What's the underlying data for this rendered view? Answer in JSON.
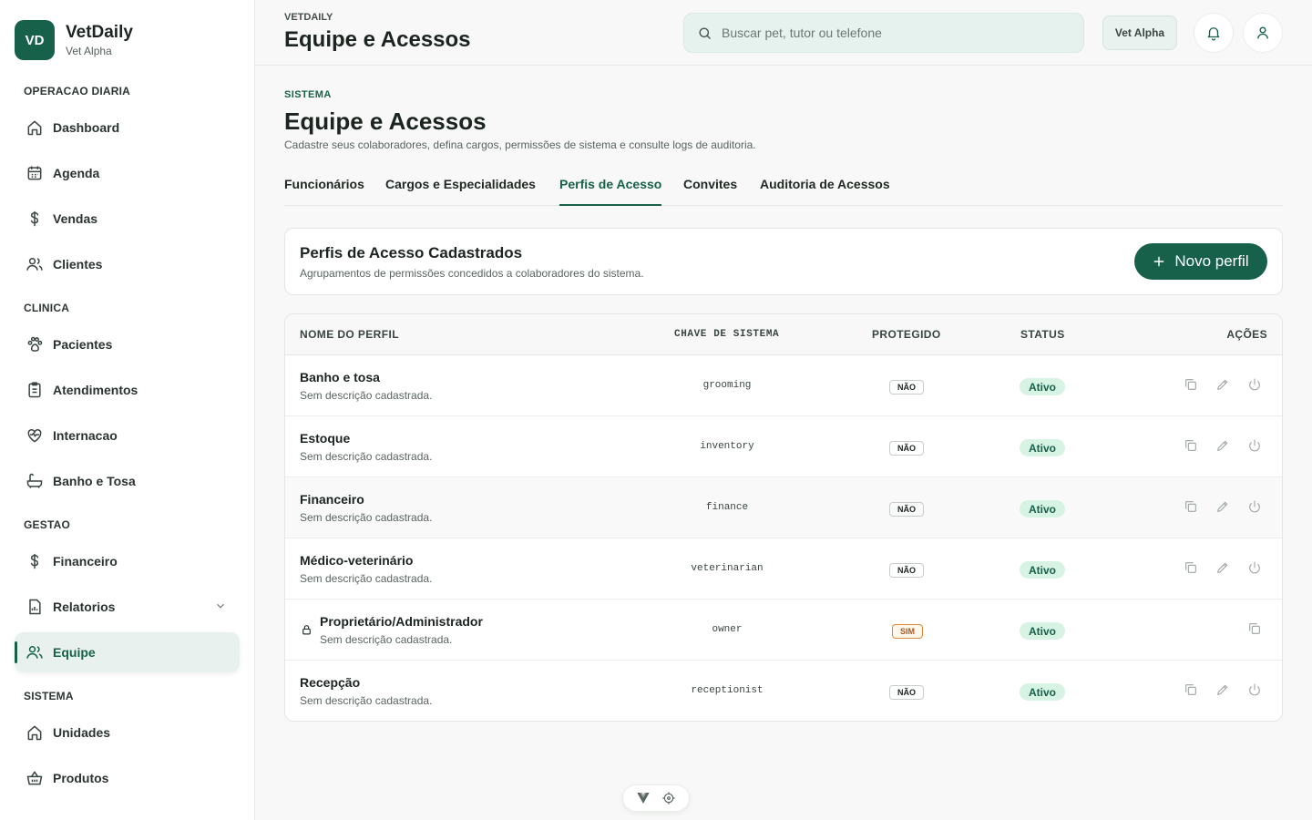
{
  "brand": {
    "initials": "VD",
    "name": "VetDaily",
    "unit": "Vet Alpha"
  },
  "sidebar": {
    "sections": [
      {
        "label": "OPERACAO DIARIA"
      },
      {
        "label": "CLINICA"
      },
      {
        "label": "GESTAO"
      },
      {
        "label": "SISTEMA"
      }
    ],
    "items": [
      {
        "label": "Dashboard",
        "icon": "home-icon"
      },
      {
        "label": "Agenda",
        "icon": "calendar-icon"
      },
      {
        "label": "Vendas",
        "icon": "dollar-icon"
      },
      {
        "label": "Clientes",
        "icon": "users-icon"
      },
      {
        "label": "Pacientes",
        "icon": "paw-icon"
      },
      {
        "label": "Atendimentos",
        "icon": "clipboard-icon"
      },
      {
        "label": "Internacao",
        "icon": "heart-pulse-icon"
      },
      {
        "label": "Banho e Tosa",
        "icon": "bath-icon"
      },
      {
        "label": "Financeiro",
        "icon": "dollar-icon"
      },
      {
        "label": "Relatorios",
        "icon": "report-icon"
      },
      {
        "label": "Equipe",
        "icon": "users-icon"
      },
      {
        "label": "Unidades",
        "icon": "home-icon"
      },
      {
        "label": "Produtos",
        "icon": "basket-icon"
      }
    ],
    "active_item": "Equipe"
  },
  "topbar": {
    "eyebrow": "VETDAILY",
    "title": "Equipe e Acessos",
    "search_placeholder": "Buscar pet, tutor ou telefone",
    "unit_button": "Vet Alpha"
  },
  "page": {
    "eyebrow": "SISTEMA",
    "title": "Equipe e Acessos",
    "subtitle": "Cadastre seus colaboradores, defina cargos, permissões de sistema e consulte logs de auditoria."
  },
  "tabs": [
    {
      "label": "Funcionários"
    },
    {
      "label": "Cargos e Especialidades"
    },
    {
      "label": "Perfis de Acesso"
    },
    {
      "label": "Convites"
    },
    {
      "label": "Auditoria de Acessos"
    }
  ],
  "active_tab": "Perfis de Acesso",
  "card": {
    "title": "Perfis de Acesso Cadastrados",
    "subtitle": "Agrupamentos de permissões concedidos a colaboradores do sistema.",
    "button_label": "Novo perfil"
  },
  "table": {
    "headers": {
      "name": "NOME DO PERFIL",
      "key": "CHAVE DE SISTEMA",
      "protected": "PROTEGIDO",
      "status": "STATUS",
      "actions": "AÇÕES"
    },
    "rows": [
      {
        "name": "Banho e tosa",
        "desc": "Sem descrição cadastrada.",
        "key": "grooming",
        "protected": "NÃO",
        "status": "Ativo"
      },
      {
        "name": "Estoque",
        "desc": "Sem descrição cadastrada.",
        "key": "inventory",
        "protected": "NÃO",
        "status": "Ativo"
      },
      {
        "name": "Financeiro",
        "desc": "Sem descrição cadastrada.",
        "key": "finance",
        "protected": "NÃO",
        "status": "Ativo"
      },
      {
        "name": "Médico-veterinário",
        "desc": "Sem descrição cadastrada.",
        "key": "veterinarian",
        "protected": "NÃO",
        "status": "Ativo"
      },
      {
        "name": "Proprietário/Administrador",
        "desc": "Sem descrição cadastrada.",
        "key": "owner",
        "protected": "SIM",
        "status": "Ativo"
      },
      {
        "name": "Recepção",
        "desc": "Sem descrição cadastrada.",
        "key": "receptionist",
        "protected": "NÃO",
        "status": "Ativo"
      }
    ]
  },
  "colors": {
    "primary": "#17614a",
    "status_bg": "#d7f3e4",
    "protected_yes": "#d98a3a"
  }
}
